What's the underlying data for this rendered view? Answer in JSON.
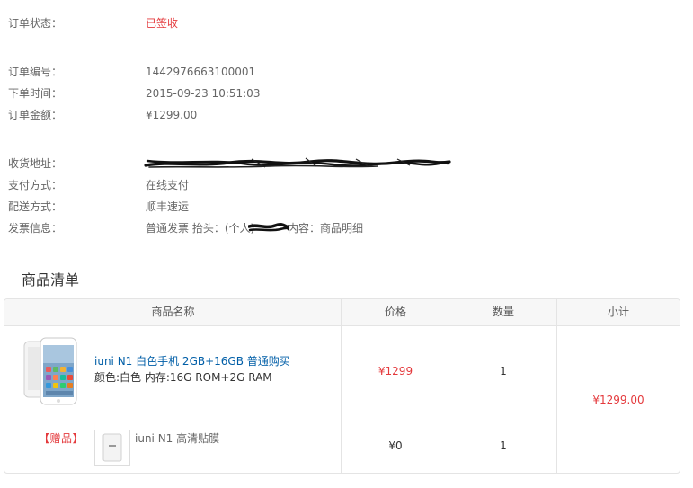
{
  "order": {
    "status_label": "订单状态：",
    "status_value": "已签收",
    "number_label": "订单编号：",
    "number_value": "1442976663100001",
    "time_label": "下单时间：",
    "time_value": "2015-09-23 10:51:03",
    "amount_label": "订单金额：",
    "amount_value": "¥1299.00"
  },
  "delivery": {
    "address_label": "收货地址：",
    "payment_label": "支付方式：",
    "payment_value": "在线支付",
    "shipping_label": "配送方式：",
    "shipping_value": "顺丰速运",
    "invoice_label": "发票信息：",
    "invoice_prefix": "普通发票 抬头：(个人)",
    "invoice_suffix": "内容：商品明细"
  },
  "goods": {
    "title": "商品清单",
    "headers": {
      "name": "商品名称",
      "price": "价格",
      "quantity": "数量",
      "subtotal": "小计"
    },
    "items": [
      {
        "name": "iuni N1 白色手机 2GB+16GB 普通购买",
        "spec": "颜色:白色 内存:16G ROM+2G RAM",
        "price": "¥1299",
        "quantity": "1"
      },
      {
        "badge": "【赠品】",
        "name": "iuni N1 高清贴膜",
        "price": "¥0",
        "quantity": "1"
      }
    ],
    "subtotal": "¥1299.00"
  },
  "colors": {
    "accent_red": "#e4393c",
    "link_blue": "#005ea7",
    "border": "#e4e4e4",
    "header_bg": "#f7f7f7"
  }
}
